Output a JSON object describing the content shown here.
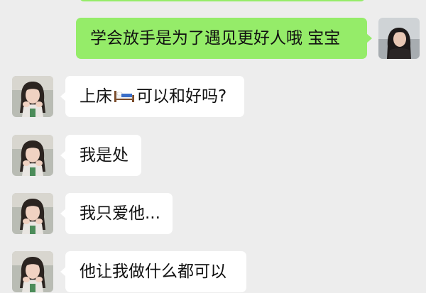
{
  "messages": [
    {
      "side": "out",
      "avatar": "self-avatar",
      "text": "学会放手是为了遇见更好人哦 宝宝"
    },
    {
      "side": "in",
      "avatar": "contact-avatar",
      "text_before": "上床",
      "icon": "bed-icon",
      "text_after": "可以和好吗?"
    },
    {
      "side": "in",
      "avatar": "contact-avatar",
      "text": "我是处"
    },
    {
      "side": "in",
      "avatar": "contact-avatar",
      "text": "我只爱他..."
    },
    {
      "side": "in",
      "avatar": "contact-avatar",
      "text": "他让我做什么都可以"
    }
  ],
  "colors": {
    "background": "#ededed",
    "outgoing_bubble": "#95ec69",
    "incoming_bubble": "#ffffff"
  }
}
